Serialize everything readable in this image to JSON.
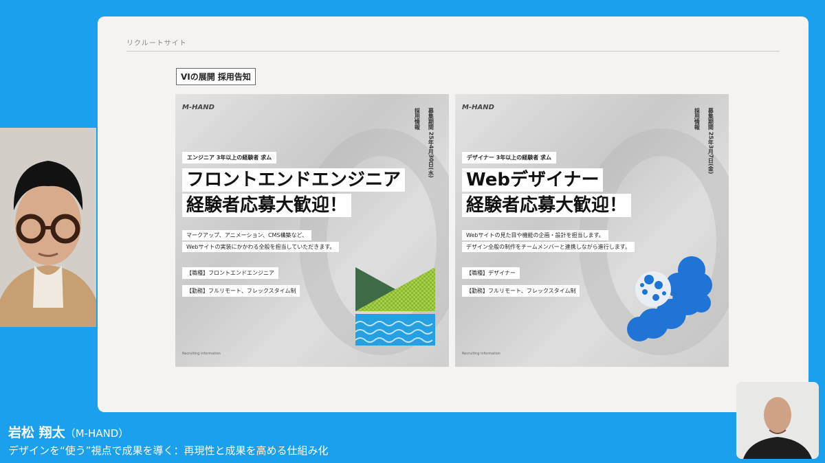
{
  "slide": {
    "section_label": "リクルートサイト",
    "heading": "VIの展開 採用告知"
  },
  "posters": [
    {
      "brand": "M-HAND",
      "vert_info": "採用情報",
      "vert_period": "募集期間 25年4月30日(水)",
      "tag": "エンジニア 3年以上の経験者 求ム",
      "title_1": "フロントエンドエンジニア",
      "title_2": "経験者応募大歓迎！",
      "desc_1": "マークアップ、アニメーション、CMS構築など、",
      "desc_2": "Webサイトの実装にかかわる全般を担当していただきます。",
      "role": "【職種】フロントエンドエンジニア",
      "work": "【勤務】フルリモート、フレックスタイム制",
      "footer": "Recruiting information"
    },
    {
      "brand": "M-HAND",
      "vert_info": "採用情報",
      "vert_period": "募集期間 25年3月7日(金)",
      "tag": "デザイナー 3年以上の経験者 求ム",
      "title_1": "Webデザイナー",
      "title_2": "経験者応募大歓迎！",
      "desc_1": "Webサイトの見た目や機能の企画・設計を担当します。",
      "desc_2": "デザイン全般の制作をチームメンバーと連携しながら進行します。",
      "role": "【職種】デザイナー",
      "work": "【勤務】フルリモート、フレックスタイム制",
      "footer": "Recruiting information"
    }
  ],
  "speaker": {
    "name": "岩松 翔太",
    "org": "（M-HAND）",
    "talk_title": "デザインを“使う”視点で成果を導く：再現性と成果を高める仕組み化"
  },
  "colors": {
    "background": "#1aa0ec",
    "green_art": "#8ab832",
    "dark_green_art": "#3e6b45",
    "blue_art": "#1f74d6"
  }
}
